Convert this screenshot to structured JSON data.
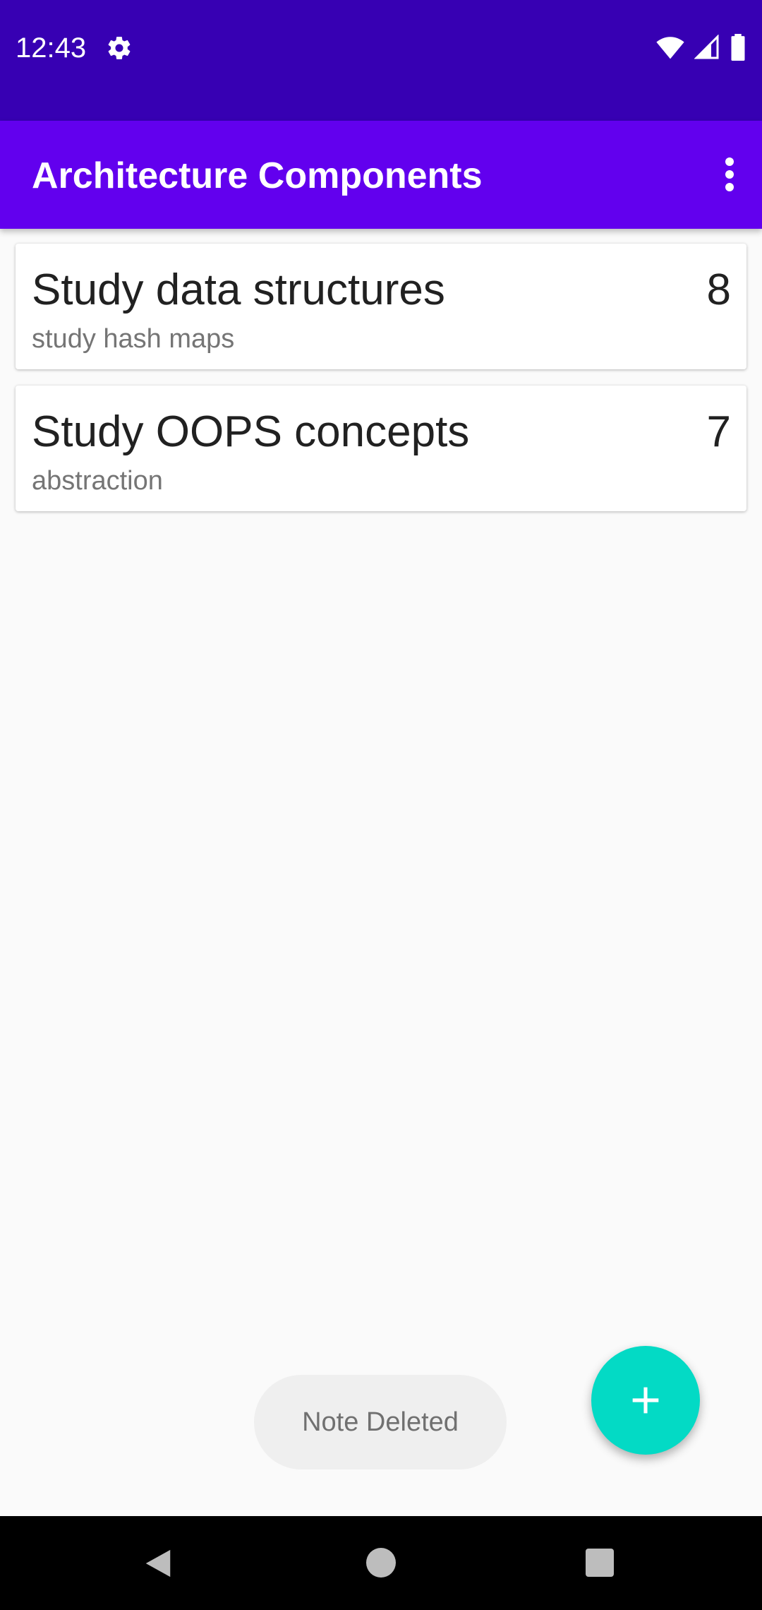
{
  "status_bar": {
    "time": "12:43",
    "left_icon": "gear-icon",
    "right_icons": [
      "wifi-icon",
      "signal-icon",
      "battery-icon"
    ],
    "background": "#3700b3"
  },
  "app_bar": {
    "title": "Architecture Components",
    "menu_icon": "overflow-menu-icon",
    "background": "#6200ee"
  },
  "notes": [
    {
      "title": "Study data structures",
      "description": "study hash maps",
      "priority": "8"
    },
    {
      "title": "Study OOPS concepts",
      "description": "abstraction",
      "priority": "7"
    }
  ],
  "toast": {
    "message": "Note Deleted"
  },
  "fab": {
    "icon": "plus-icon",
    "color": "#03dac5"
  },
  "nav_bar": {
    "icons": [
      "back-icon",
      "home-icon",
      "recents-icon"
    ]
  }
}
